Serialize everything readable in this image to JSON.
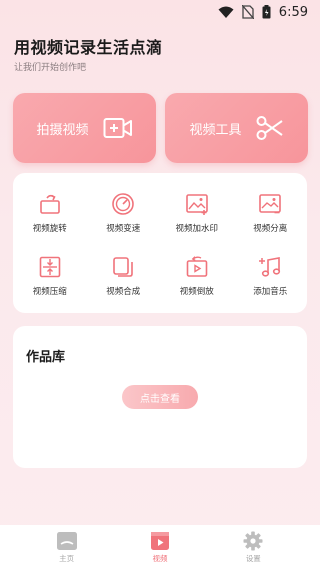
{
  "status_bar": {
    "time": "6:59",
    "icons": [
      "wifi-icon",
      "no-sim-icon",
      "battery-icon"
    ]
  },
  "header": {
    "title": "用视频记录生活点滴",
    "subtitle": "让我们开始创作吧"
  },
  "big_cards": [
    {
      "label": "拍摄视频",
      "icon": "video-camera-add-icon"
    },
    {
      "label": "视频工具",
      "icon": "scissors-icon"
    }
  ],
  "tools": [
    {
      "label": "视频旋转",
      "icon": "rotate-icon"
    },
    {
      "label": "视频变速",
      "icon": "speedometer-icon"
    },
    {
      "label": "视频加水印",
      "icon": "watermark-image-icon"
    },
    {
      "label": "视频分离",
      "icon": "split-image-icon"
    },
    {
      "label": "视频压缩",
      "icon": "compress-icon"
    },
    {
      "label": "视频合成",
      "icon": "merge-icon"
    },
    {
      "label": "视频倒放",
      "icon": "reverse-play-icon"
    },
    {
      "label": "添加音乐",
      "icon": "add-music-icon"
    }
  ],
  "library": {
    "title": "作品库",
    "button_label": "点击查看"
  },
  "tab_bar": {
    "items": [
      {
        "label": "主页",
        "icon": "home-icon",
        "active": false
      },
      {
        "label": "视频",
        "icon": "video-icon",
        "active": true
      },
      {
        "label": "设置",
        "icon": "gear-icon",
        "active": false
      }
    ]
  },
  "colors": {
    "accent": "#f7959b",
    "icon_stroke": "#f0737b",
    "background": "#fbe3e6"
  }
}
